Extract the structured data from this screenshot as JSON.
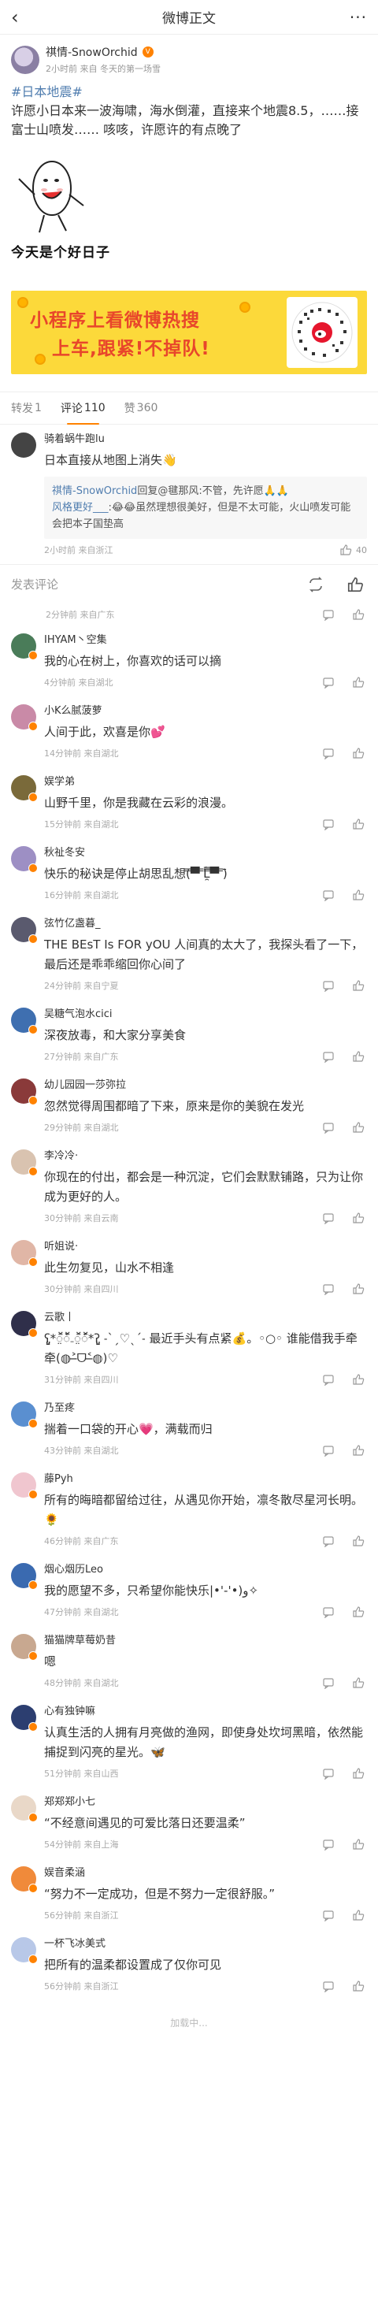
{
  "navbar": {
    "title": "微博正文",
    "back": "‹",
    "more": "···"
  },
  "post": {
    "author": "祺情-SnowOrchid",
    "meta": "2小时前 来自 冬天的第一场雪",
    "hashtag": "#日本地震#",
    "text": "许愿小日本来一波海啸，海水倒灌，直接来个地震8.5，……接富士山喷发…… 咳咳，许愿许的有点晚了",
    "meme_caption": "今天是个好日子"
  },
  "banner": {
    "line1": "小程序上看微博热搜",
    "line2": "上车,跟紧!不掉队!"
  },
  "tabs": [
    {
      "label": "转发",
      "count": "1"
    },
    {
      "label": "评论",
      "count": "110"
    },
    {
      "label": "赞",
      "count": "360"
    }
  ],
  "top_comment": {
    "name": "骑着蜗牛跑lu",
    "text": "日本直接从地图上消失👋",
    "reply_lines": [
      {
        "name": "祺情-SnowOrchid",
        "text": "回复@毽那风:不管，先许愿🙏🙏"
      },
      {
        "name": "风格更好___",
        "text": ":😂😂虽然理想很美好，但是不太可能，火山喷发可能会把本子国垫高"
      }
    ],
    "meta": "2小时前 来自浙江",
    "likes": "40"
  },
  "compose": {
    "placeholder": "发表评论"
  },
  "mid_meta": "2分钟前 来自广东",
  "comments": [
    {
      "name": "IHYAM丶空集",
      "text": "我的心在树上，你喜欢的话可以摘",
      "meta": "4分钟前 来自湖北",
      "color": "#4a7c59"
    },
    {
      "name": "小K么腻菠萝",
      "text": "人间于此，欢喜是你💕",
      "meta": "14分钟前 来自湖北",
      "color": "#c98aa7"
    },
    {
      "name": "娱学弟",
      "text": "山野千里，你是我藏在云彩的浪漫。",
      "meta": "15分钟前 来自湖北",
      "color": "#7a6a3a"
    },
    {
      "name": "秋祉冬安",
      "text": "快乐的秘诀是停止胡思乱想(̿▀̿ ̿Ĺ̯̿̿▀̿ ̿)̄",
      "meta": "16分钟前 来自湖北",
      "color": "#9d8fc4"
    },
    {
      "name": "弦竹亿盏暮_",
      "text": "THE BEsT Is FOR yOU 人间真的太大了，我探头看了一下，最后还是乖乖缩回你心间了",
      "meta": "24分钟前 来自宁夏",
      "color": "#5a5a6e"
    },
    {
      "name": "吴糖气泡水cici",
      "text": "深夜放毒，和大家分享美食",
      "meta": "27分钟前 来自广东",
      "color": "#3f6fb0"
    },
    {
      "name": "幼儿园园一莎弥拉",
      "text": "忽然觉得周围都暗了下来，原来是你的美貌在发光",
      "meta": "29分钟前 来自湖北",
      "color": "#8a3a3a"
    },
    {
      "name": "李冷冷·",
      "text": "你现在的付出，都会是一种沉淀，它们会默默铺路，只为让你成为更好的人。",
      "meta": "30分钟前 来自云南",
      "color": "#d9c3b0"
    },
    {
      "name": "听姐说·",
      "text": "此生勿复见，山水不相逢",
      "meta": "30分钟前 来自四川",
      "color": "#e0b6a6"
    },
    {
      "name": "云歌丨",
      "text": "ʕ̡̢̡*ॕ̤ॕ̀₋ॕ̤ॕ́*ʔ̢̡̢ ˗ˋˏ♡ˎˊ˗ 最近手头有点紧💰。◦○◦ 谁能借我手牵牵(◍˃̶ᗜ˂̶◍)♡",
      "meta": "31分钟前 来自四川",
      "color": "#2f2f4a"
    },
    {
      "name": "乃至疼",
      "text": "揣着一口袋的开心💗，满载而归",
      "meta": "43分钟前 来自湖北",
      "color": "#5a8fd0"
    },
    {
      "name": "藤Pyh",
      "text": "所有的晦暗都留给过往，从遇见你开始，凛冬散尽星河长明。🌻",
      "meta": "46分钟前 来自广东",
      "color": "#f0c6cf"
    },
    {
      "name": "烟心烟历Leo",
      "text": "我的愿望不多，只希望你能快乐|•'-'•)و✧",
      "meta": "47分钟前 来自湖北",
      "color": "#3a6ab0"
    },
    {
      "name": "猫猫牌草莓奶昔",
      "text": "嗯",
      "meta": "48分钟前 来自湖北",
      "color": "#c8a890"
    },
    {
      "name": "心有独钟嘛",
      "text": "认真生活的人拥有月亮做的渔网，即使身处坎坷黑暗，依然能捕捉到闪亮的星光。🦋",
      "meta": "51分钟前 来自山西",
      "color": "#2c3e70"
    },
    {
      "name": "郑郑郑小七",
      "text": "“不经意间遇见的可爱比落日还要温柔”",
      "meta": "54分钟前 来自上海",
      "color": "#e9d8c8"
    },
    {
      "name": "娱音柔涵",
      "text": "“努力不一定成功，但是不努力一定很舒服。”",
      "meta": "56分钟前 来自浙江",
      "color": "#f08a3a"
    },
    {
      "name": "一杯飞冰美式",
      "text": "把所有的温柔都设置成了仅你可见",
      "meta": "56分钟前 来自浙江",
      "color": "#b8c8e8"
    }
  ],
  "loading": "加载中..."
}
